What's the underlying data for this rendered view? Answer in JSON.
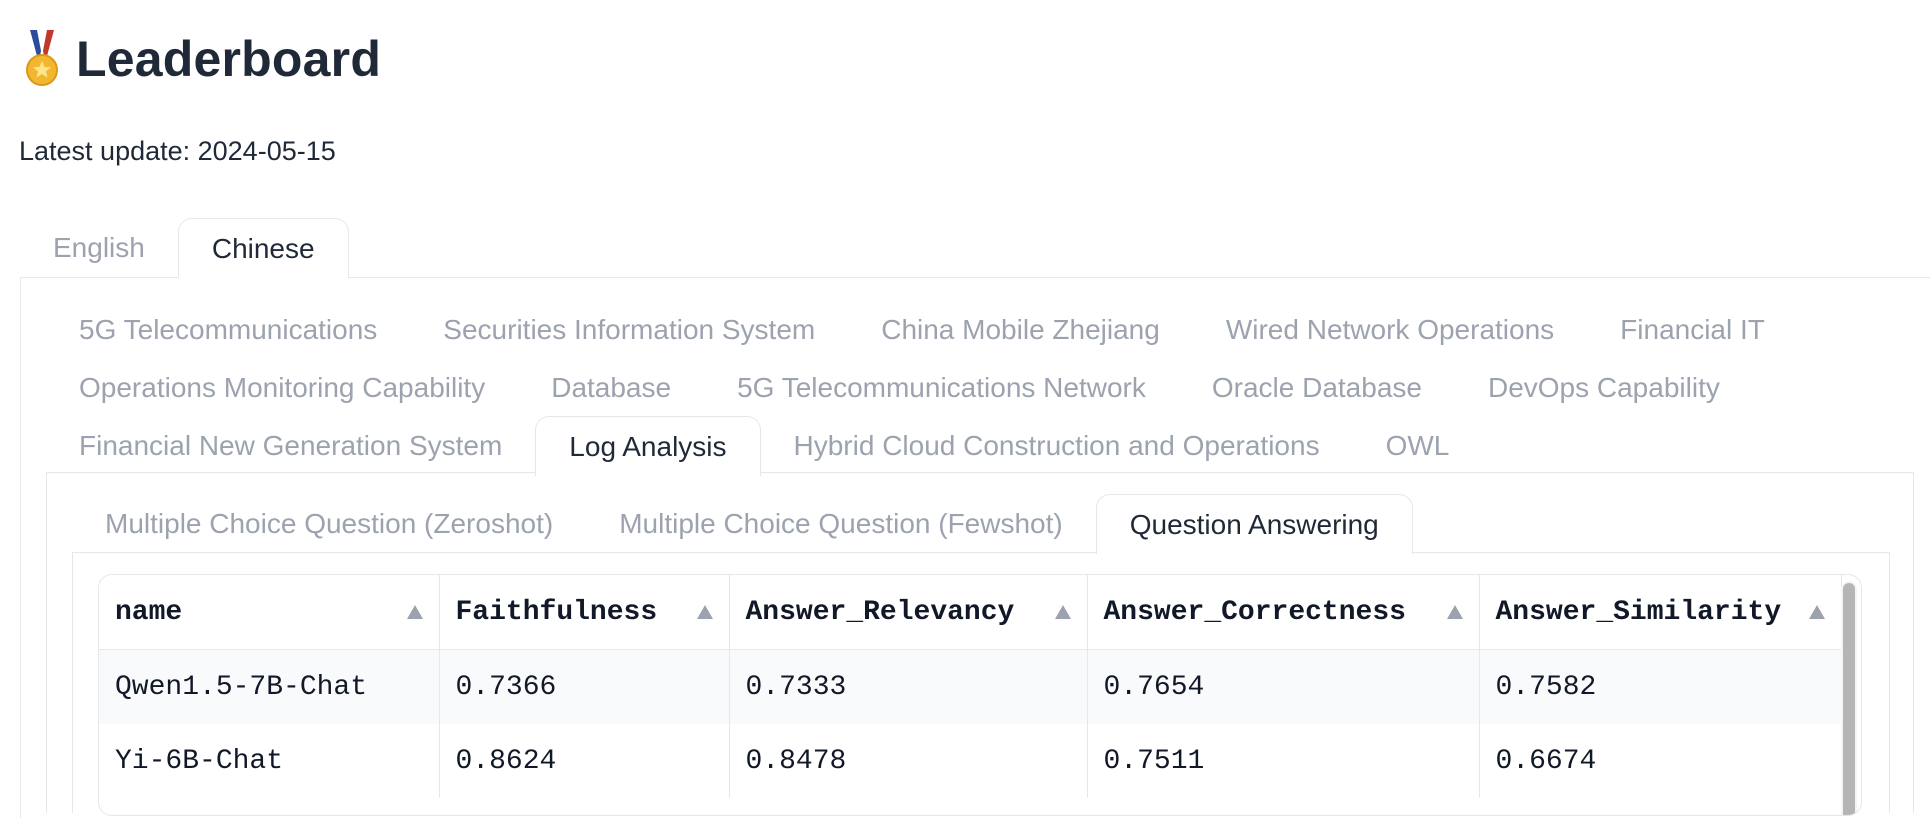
{
  "header": {
    "title": "Leaderboard",
    "icon": "medal-icon",
    "latest_update": "Latest update: 2024-05-15"
  },
  "language_tabs": [
    {
      "label": "English",
      "selected": false
    },
    {
      "label": "Chinese",
      "selected": true
    }
  ],
  "domain_tabs": [
    [
      {
        "label": "5G Telecommunications",
        "selected": false
      },
      {
        "label": "Securities Information System",
        "selected": false
      },
      {
        "label": "China Mobile Zhejiang",
        "selected": false
      },
      {
        "label": "Wired Network Operations",
        "selected": false
      },
      {
        "label": "Financial IT",
        "selected": false
      }
    ],
    [
      {
        "label": "Operations Monitoring Capability",
        "selected": false
      },
      {
        "label": "Database",
        "selected": false
      },
      {
        "label": "5G Telecommunications Network",
        "selected": false
      },
      {
        "label": "Oracle Database",
        "selected": false
      },
      {
        "label": "DevOps Capability",
        "selected": false
      }
    ],
    [
      {
        "label": "Financial New Generation System",
        "selected": false
      },
      {
        "label": "Log Analysis",
        "selected": true
      },
      {
        "label": "Hybrid Cloud Construction and Operations",
        "selected": false
      },
      {
        "label": "OWL",
        "selected": false
      }
    ]
  ],
  "task_tabs": [
    {
      "label": "Multiple Choice Question (Zeroshot)",
      "selected": false
    },
    {
      "label": "Multiple Choice Question (Fewshot)",
      "selected": false
    },
    {
      "label": "Question Answering",
      "selected": true
    }
  ],
  "table": {
    "columns": [
      "name",
      "Faithfulness",
      "Answer_Relevancy",
      "Answer_Correctness",
      "Answer_Similarity"
    ],
    "rows": [
      [
        "Qwen1.5-7B-Chat",
        "0.7366",
        "0.7333",
        "0.7654",
        "0.7582"
      ],
      [
        "Yi-6B-Chat",
        "0.8624",
        "0.8478",
        "0.7511",
        "0.6674"
      ]
    ]
  },
  "colors": {
    "text_primary": "#1f2937",
    "text_muted": "#9ca3af",
    "border": "#e5e7eb",
    "row_stripe": "#f9fafb"
  }
}
